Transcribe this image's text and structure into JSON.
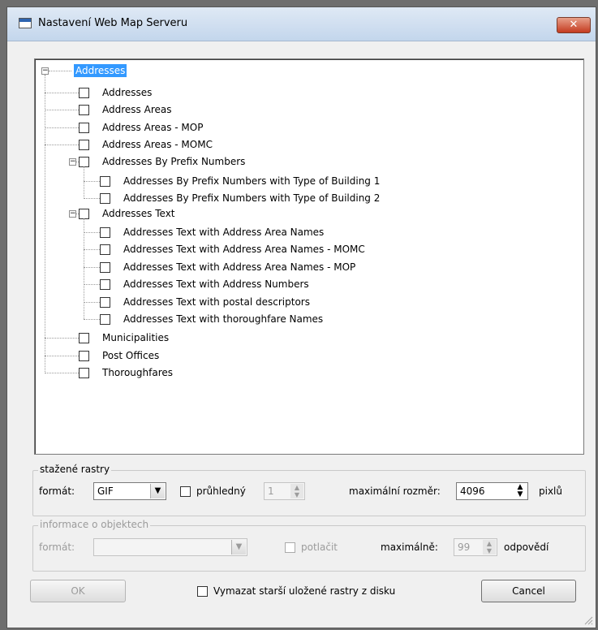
{
  "window": {
    "title": "Nastavení Web Map Serveru",
    "close_glyph": "✕",
    "icon": "app-window-icon"
  },
  "tree": {
    "root": "Addresses",
    "items": [
      "Addresses",
      "Address Areas",
      "Address Areas - MOP",
      "Address Areas - MOMC",
      "Addresses By Prefix Numbers",
      "Addresses By Prefix Numbers with Type of Building 1",
      "Addresses By Prefix Numbers with Type of Building 2",
      "Addresses Text",
      "Addresses Text with Address Area Names",
      "Addresses Text with Address Area Names - MOMC",
      "Addresses Text with Address Area Names - MOP",
      "Addresses Text with Address Numbers",
      "Addresses Text with postal descriptors",
      "Addresses Text with thoroughfare Names",
      "Municipalities",
      "Post Offices",
      "Thoroughfares"
    ]
  },
  "raster": {
    "legend": "stažené rastry",
    "format_label": "formát:",
    "format_value": "GIF",
    "transparent_label": "průhledný",
    "spin_value": "1",
    "maxsize_label": "maximální rozměr:",
    "maxsize_value": "4096",
    "unit": "pixlů"
  },
  "objects": {
    "legend": "informace o objektech",
    "format_label": "formát:",
    "suppress_label": "potlačit",
    "max_label": "maximálně:",
    "max_value": "99",
    "unit": "odpovědí"
  },
  "footer": {
    "ok_label": "OK",
    "clear_label": "Vymazat starší uložené rastry z disku",
    "cancel_label": "Cancel"
  }
}
